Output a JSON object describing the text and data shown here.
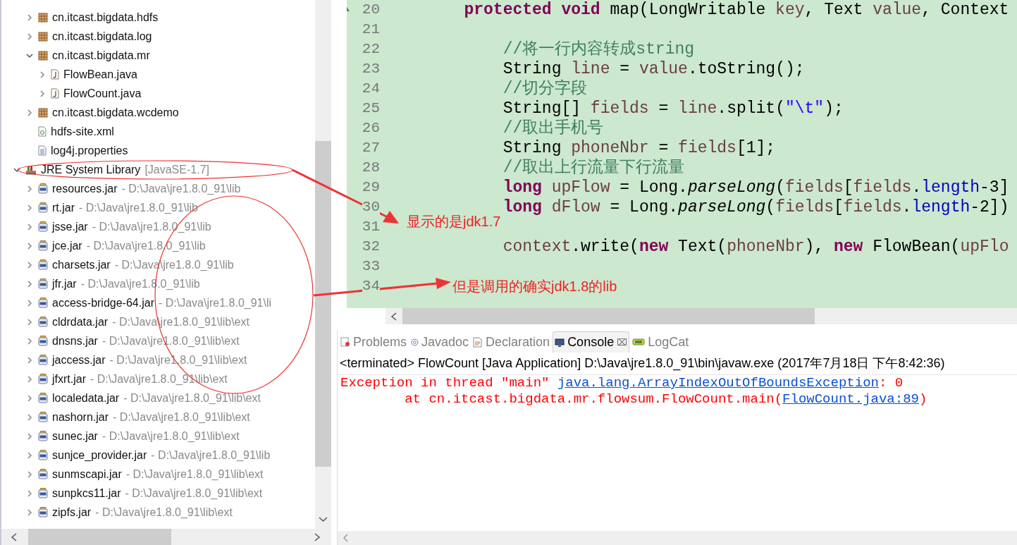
{
  "package_explorer": {
    "source_folder_contents": [
      {
        "label": "cn.itcast.bigdata.hdfs",
        "kind": "package",
        "expanded": false
      },
      {
        "label": "cn.itcast.bigdata.log",
        "kind": "package",
        "expanded": false
      },
      {
        "label": "cn.itcast.bigdata.mr",
        "kind": "package",
        "expanded": true,
        "children": [
          {
            "label": "FlowBean.java",
            "kind": "java",
            "expanded": false
          },
          {
            "label": "FlowCount.java",
            "kind": "java",
            "expanded": false
          }
        ]
      },
      {
        "label": "cn.itcast.bigdata.wcdemo",
        "kind": "package",
        "expanded": false
      },
      {
        "label": "hdfs-site.xml",
        "kind": "xml"
      },
      {
        "label": "log4j.properties",
        "kind": "properties"
      }
    ],
    "libraries": [
      {
        "label": "JRE System Library",
        "detail": "[JavaSE-1.7]",
        "kind": "library",
        "expanded": true,
        "children": [
          {
            "label": "resources.jar",
            "detail": "- D:\\Java\\jre1.8.0_91\\lib",
            "kind": "jar",
            "expanded": false
          },
          {
            "label": "rt.jar",
            "detail": "- D:\\Java\\jre1.8.0_91\\lib",
            "kind": "jar",
            "expanded": false
          },
          {
            "label": "jsse.jar",
            "detail": "- D:\\Java\\jre1.8.0_91\\lib",
            "kind": "jar",
            "expanded": false
          },
          {
            "label": "jce.jar",
            "detail": "- D:\\Java\\jre1.8.0_91\\lib",
            "kind": "jar",
            "expanded": false
          },
          {
            "label": "charsets.jar",
            "detail": "- D:\\Java\\jre1.8.0_91\\lib",
            "kind": "jar",
            "expanded": false
          },
          {
            "label": "jfr.jar",
            "detail": "- D:\\Java\\jre1.8.0_91\\lib",
            "kind": "jar",
            "expanded": false
          },
          {
            "label": "access-bridge-64.jar",
            "detail": "- D:\\Java\\jre1.8.0_91\\li",
            "kind": "jar",
            "expanded": false
          },
          {
            "label": "cldrdata.jar",
            "detail": "- D:\\Java\\jre1.8.0_91\\lib\\ext",
            "kind": "jar",
            "expanded": false
          },
          {
            "label": "dnsns.jar",
            "detail": "- D:\\Java\\jre1.8.0_91\\lib\\ext",
            "kind": "jar",
            "expanded": false
          },
          {
            "label": "jaccess.jar",
            "detail": "- D:\\Java\\jre1.8.0_91\\lib\\ext",
            "kind": "jar",
            "expanded": false
          },
          {
            "label": "jfxrt.jar",
            "detail": "- D:\\Java\\jre1.8.0_91\\lib\\ext",
            "kind": "jar",
            "expanded": false
          },
          {
            "label": "localedata.jar",
            "detail": "- D:\\Java\\jre1.8.0_91\\lib\\ext",
            "kind": "jar",
            "expanded": false
          },
          {
            "label": "nashorn.jar",
            "detail": "- D:\\Java\\jre1.8.0_91\\lib\\ext",
            "kind": "jar",
            "expanded": false
          },
          {
            "label": "sunec.jar",
            "detail": "- D:\\Java\\jre1.8.0_91\\lib\\ext",
            "kind": "jar",
            "expanded": false
          },
          {
            "label": "sunjce_provider.jar",
            "detail": "- D:\\Java\\jre1.8.0_91\\lib",
            "kind": "jar",
            "expanded": false
          },
          {
            "label": "sunmscapi.jar",
            "detail": "- D:\\Java\\jre1.8.0_91\\lib\\ext",
            "kind": "jar",
            "expanded": false
          },
          {
            "label": "sunpkcs11.jar",
            "detail": "- D:\\Java\\jre1.8.0_91\\lib\\ext",
            "kind": "jar",
            "expanded": false
          },
          {
            "label": "zipfs.jar",
            "detail": "- D:\\Java\\jre1.8.0_91\\lib\\ext",
            "kind": "jar",
            "expanded": false
          }
        ]
      }
    ]
  },
  "editor": {
    "lines": [
      {
        "number": "20",
        "marker": true,
        "tokens": [
          {
            "text": "        protected",
            "kind": "keyword"
          },
          {
            "text": " void",
            "kind": "keyword"
          },
          {
            "text": " map(LongWritable "
          },
          {
            "text": "key",
            "kind": "variable"
          },
          {
            "text": ", Text "
          },
          {
            "text": "value",
            "kind": "variable"
          },
          {
            "text": ", Context"
          }
        ]
      },
      {
        "number": "21",
        "marker": false
      },
      {
        "number": "22",
        "marker": false,
        "tokens": [
          {
            "text": "            //将一行内容转成string",
            "kind": "comment"
          }
        ]
      },
      {
        "number": "23",
        "marker": false,
        "tokens": [
          {
            "text": "            String "
          },
          {
            "text": "line",
            "kind": "variable"
          },
          {
            "text": " = "
          },
          {
            "text": "value",
            "kind": "variable"
          },
          {
            "text": ".toString();"
          }
        ]
      },
      {
        "number": "24",
        "marker": false,
        "tokens": [
          {
            "text": "            //切分字段",
            "kind": "comment"
          }
        ]
      },
      {
        "number": "25",
        "marker": false,
        "tokens": [
          {
            "text": "            String[] "
          },
          {
            "text": "fields",
            "kind": "variable"
          },
          {
            "text": " = "
          },
          {
            "text": "line",
            "kind": "variable"
          },
          {
            "text": ".split("
          },
          {
            "text": "\"\\t\"",
            "kind": "string"
          },
          {
            "text": ");"
          }
        ]
      },
      {
        "number": "26",
        "marker": false,
        "tokens": [
          {
            "text": "            //取出手机号",
            "kind": "comment"
          }
        ]
      },
      {
        "number": "27",
        "marker": false,
        "tokens": [
          {
            "text": "            String "
          },
          {
            "text": "phoneNbr",
            "kind": "variable"
          },
          {
            "text": " = "
          },
          {
            "text": "fields",
            "kind": "variable"
          },
          {
            "text": "[1];"
          }
        ]
      },
      {
        "number": "28",
        "marker": false,
        "tokens": [
          {
            "text": "            //取出上行流量下行流量",
            "kind": "comment"
          }
        ]
      },
      {
        "number": "29",
        "marker": false,
        "tokens": [
          {
            "text": "            long",
            "kind": "keyword"
          },
          {
            "text": " upFlow",
            "kind": "variable"
          },
          {
            "text": " = Long."
          },
          {
            "text": "parseLong",
            "kind": "static"
          },
          {
            "text": "("
          },
          {
            "text": "fields",
            "kind": "variable"
          },
          {
            "text": "["
          },
          {
            "text": "fields",
            "kind": "variable"
          },
          {
            "text": "."
          },
          {
            "text": "length",
            "kind": "field"
          },
          {
            "text": "-3]"
          }
        ]
      },
      {
        "number": "30",
        "marker": false,
        "tokens": [
          {
            "text": "            long",
            "kind": "keyword"
          },
          {
            "text": " dFlow",
            "kind": "variable"
          },
          {
            "text": " = Long."
          },
          {
            "text": "parseLong",
            "kind": "static"
          },
          {
            "text": "("
          },
          {
            "text": "fields",
            "kind": "variable"
          },
          {
            "text": "["
          },
          {
            "text": "fields",
            "kind": "variable"
          },
          {
            "text": "."
          },
          {
            "text": "length",
            "kind": "field"
          },
          {
            "text": "-2])"
          }
        ]
      },
      {
        "number": "31",
        "marker": false
      },
      {
        "number": "32",
        "marker": false,
        "tokens": [
          {
            "text": "            context",
            "kind": "variable"
          },
          {
            "text": ".write("
          },
          {
            "text": "new",
            "kind": "keyword"
          },
          {
            "text": " Text("
          },
          {
            "text": "phoneNbr",
            "kind": "variable"
          },
          {
            "text": "), "
          },
          {
            "text": "new",
            "kind": "keyword"
          },
          {
            "text": " FlowBean("
          },
          {
            "text": "upFlo",
            "kind": "variable"
          }
        ]
      },
      {
        "number": "33",
        "marker": false
      },
      {
        "number": "34",
        "marker": false
      }
    ]
  },
  "bottom_panel": {
    "tabs": [
      {
        "label": "Problems",
        "kind": "problems",
        "selected": false
      },
      {
        "label": "Javadoc",
        "kind": "javadoc",
        "selected": false
      },
      {
        "label": "Declaration",
        "kind": "declaration",
        "selected": false
      },
      {
        "label": "Console",
        "kind": "console",
        "selected": true,
        "close": "⌧"
      },
      {
        "label": "LogCat",
        "kind": "logcat",
        "selected": false
      }
    ],
    "console": {
      "status": "<terminated> FlowCount [Java Application] D:\\Java\\jre1.8.0_91\\bin\\javaw.exe (2017年7月18日 下午8:42:36)",
      "lines": [
        [
          {
            "text": "Exception in thread \"main\" ",
            "kind": "error"
          },
          {
            "text": "java.lang.ArrayIndexOutOfBoundsException",
            "kind": "link"
          },
          {
            "text": ": 0",
            "kind": "error"
          }
        ],
        [
          {
            "text": "        at cn.itcast.bigdata.mr.flowsum.FlowCount.main(",
            "kind": "error"
          },
          {
            "text": "FlowCount.java:89",
            "kind": "link"
          },
          {
            "text": ")",
            "kind": "error"
          }
        ]
      ]
    }
  },
  "annotations": [
    {
      "text": "显示的是jdk1.7"
    },
    {
      "text": "但是调用的确实jdk1.8的lib"
    }
  ]
}
